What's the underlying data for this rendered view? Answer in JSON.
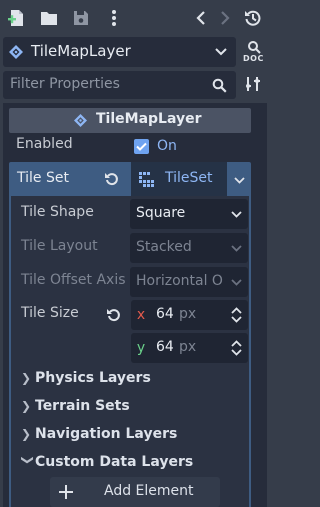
{
  "toolbar": {
    "icons": [
      "new-script-icon",
      "folder-open-icon",
      "save-icon",
      "more-vertical-icon",
      "history-back-icon",
      "history-forward-icon",
      "object-history-icon"
    ]
  },
  "node_selector": {
    "label": "TileMapLayer",
    "doc_label": "DOC"
  },
  "filter": {
    "placeholder": "Filter Properties"
  },
  "inspector": {
    "section_title": "TileMapLayer",
    "enabled": {
      "label": "Enabled",
      "value": "On",
      "checked": true
    },
    "tile_set": {
      "label": "Tile Set",
      "value": "TileSet"
    },
    "tile_shape": {
      "label": "Tile Shape",
      "value": "Square"
    },
    "tile_layout": {
      "label": "Tile Layout",
      "value": "Stacked"
    },
    "tile_offset_axis": {
      "label": "Tile Offset Axis",
      "value": "Horizontal O"
    },
    "tile_size": {
      "label": "Tile Size",
      "x_label": "x",
      "x": "64",
      "y_label": "y",
      "y": "64",
      "unit": "px"
    },
    "groups": [
      {
        "label": "Physics Layers",
        "expanded": false
      },
      {
        "label": "Terrain Sets",
        "expanded": false
      },
      {
        "label": "Navigation Layers",
        "expanded": false
      },
      {
        "label": "Custom Data Layers",
        "expanded": true
      }
    ],
    "add_element_label": "Add Element"
  },
  "colors": {
    "accent": "#8eb6f4",
    "check": "#6fa3f0",
    "axis_x": "#e25a4c",
    "axis_y": "#6ad08a",
    "selected_row": "#3e5c82"
  }
}
